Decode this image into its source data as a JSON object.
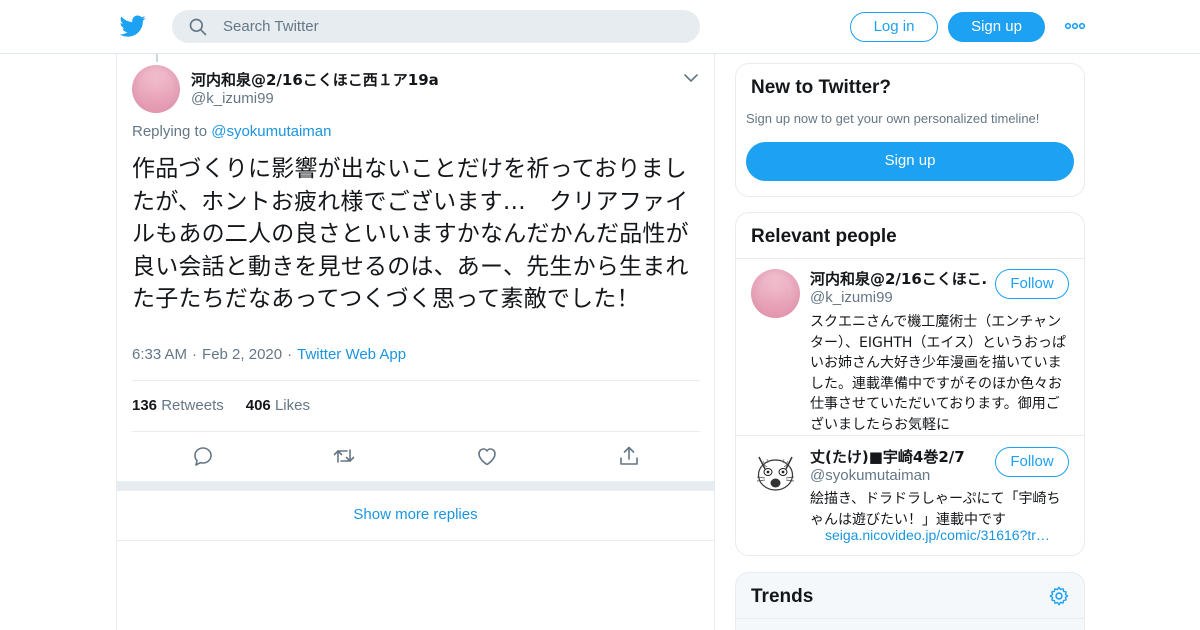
{
  "header": {
    "search_placeholder": "Search Twitter",
    "login_label": "Log in",
    "signup_label": "Sign up"
  },
  "tweet": {
    "author_name": "河内和泉@2/16こくほこ西１ア19a",
    "author_handle": "@k_izumi99",
    "replying_prefix": "Replying to",
    "replying_to": "@syokumutaiman",
    "text": "作品づくりに影響が出ないことだけを祈っておりましたが、ホントお疲れ様でございます…　クリアファイルもあの二人の良さといいますかなんだかんだ品性が良い会話と動きを見せるのは、あー、先生から生まれた子たちだなあってつくづく思って素敵でした！",
    "time": "6:33 AM",
    "date": "Feb 2, 2020",
    "source": "Twitter Web App",
    "retweets_count": "136",
    "retweets_label": "Retweets",
    "likes_count": "406",
    "likes_label": "Likes"
  },
  "show_more_replies": "Show more replies",
  "sidebar": {
    "new_to_twitter": {
      "title": "New to Twitter?",
      "subtitle": "Sign up now to get your own personalized timeline!",
      "signup_label": "Sign up"
    },
    "relevant_people": {
      "title": "Relevant people",
      "people": [
        {
          "name": "河内和泉@2/16こくほこ…",
          "handle": "@k_izumi99",
          "follow_label": "Follow",
          "bio": "スクエニさんで機工魔術士（エンチャンター）、EIGHTH（エイス）というおっぱいお姉さん大好き少年漫画を描いていました。連載準備中ですがそのほか色々お仕事させていただいております。御用ございましたらお気軽に"
        },
        {
          "name": "丈(たけ)■宇崎4巻2/7",
          "handle": "@syokumutaiman",
          "follow_label": "Follow",
          "bio": "絵描き、ドラドラしゃーぷにて「宇崎ちゃんは遊びたい！」連載中です",
          "link": "seiga.nicovideo.jp/comic/31616?tr…"
        }
      ]
    },
    "trends": {
      "title": "Trends"
    }
  },
  "colors": {
    "accent": "#1da1f2",
    "link": "#1b95e0",
    "secondary_text": "#657786"
  }
}
